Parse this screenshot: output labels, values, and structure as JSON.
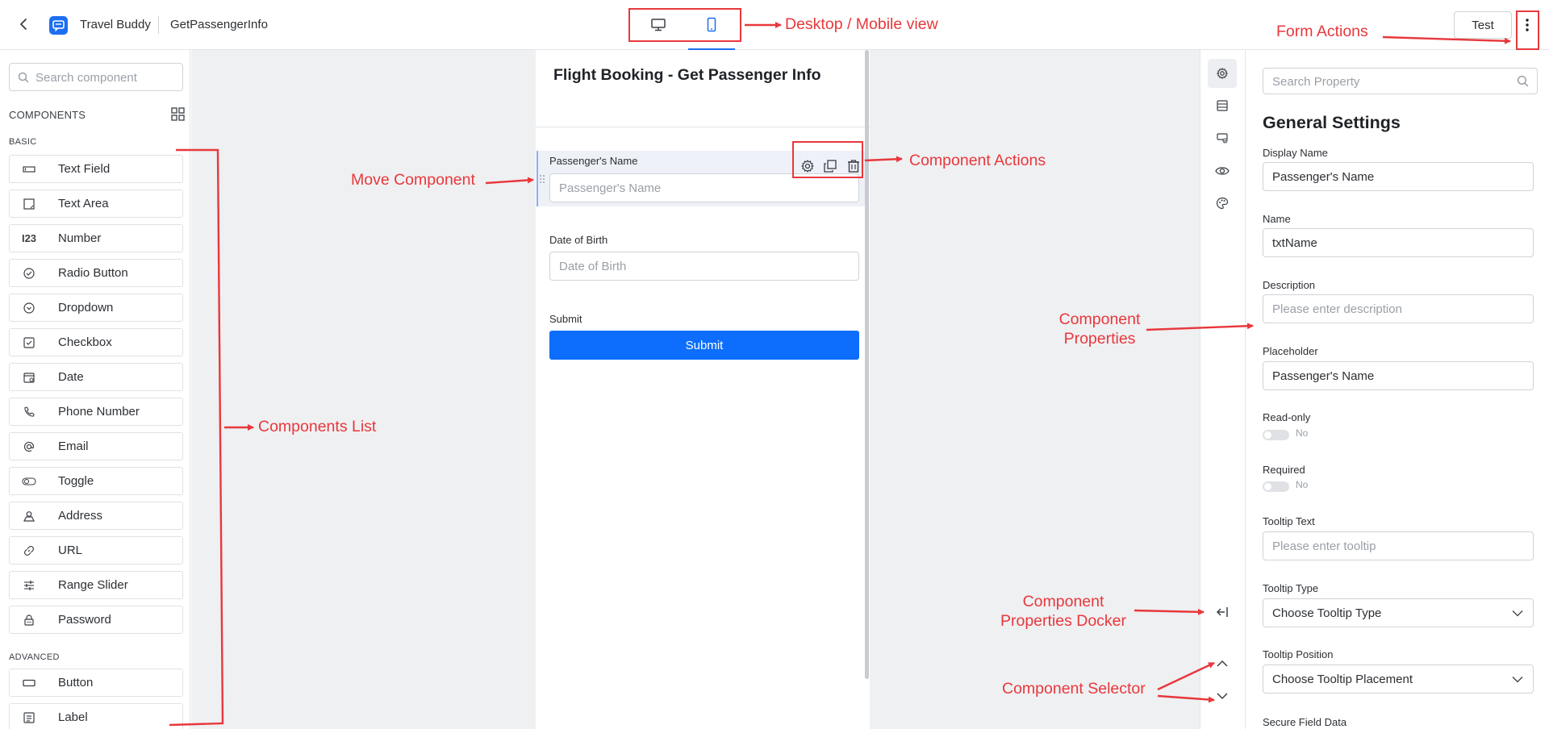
{
  "topbar": {
    "app_name": "Travel Buddy",
    "form_name": "GetPassengerInfo",
    "views": [
      "desktop-icon",
      "mobile-icon"
    ],
    "active_view": "mobile",
    "test_label": "Test"
  },
  "components": {
    "search_placeholder": "Search component",
    "header": "COMPONENTS",
    "basic_label": "BASIC",
    "basic": [
      {
        "label": "Text Field",
        "icon": "text-field-icon"
      },
      {
        "label": "Text Area",
        "icon": "text-area-icon"
      },
      {
        "label": "Number",
        "icon": "number-icon",
        "glyph": "I23"
      },
      {
        "label": "Radio Button",
        "icon": "radio-icon"
      },
      {
        "label": "Dropdown",
        "icon": "dropdown-icon"
      },
      {
        "label": "Checkbox",
        "icon": "checkbox-icon"
      },
      {
        "label": "Date",
        "icon": "calendar-icon"
      },
      {
        "label": "Phone Number",
        "icon": "phone-icon"
      },
      {
        "label": "Email",
        "icon": "at-icon"
      },
      {
        "label": "Toggle",
        "icon": "toggle-icon"
      },
      {
        "label": "Address",
        "icon": "address-icon"
      },
      {
        "label": "URL",
        "icon": "link-icon"
      },
      {
        "label": "Range Slider",
        "icon": "sliders-icon"
      },
      {
        "label": "Password",
        "icon": "lock-icon"
      }
    ],
    "advanced_label": "ADVANCED",
    "advanced": [
      {
        "label": "Button",
        "icon": "button-icon"
      },
      {
        "label": "Label",
        "icon": "label-icon"
      }
    ]
  },
  "form": {
    "title": "Flight Booking - Get Passenger Info",
    "fields": [
      {
        "label": "Passenger's Name",
        "placeholder": "Passenger's Name"
      },
      {
        "label": "Date of Birth",
        "placeholder": "Date of Birth"
      }
    ],
    "submit_label": "Submit",
    "submit_button": "Submit"
  },
  "properties": {
    "search_placeholder": "Search Property",
    "section_title": "General Settings",
    "display_name_label": "Display Name",
    "display_name_value": "Passenger's Name",
    "name_label": "Name",
    "name_value": "txtName",
    "description_label": "Description",
    "description_placeholder": "Please enter description",
    "placeholder_label": "Placeholder",
    "placeholder_value": "Passenger's Name",
    "readonly_label": "Read-only",
    "readonly_value": "No",
    "required_label": "Required",
    "required_value": "No",
    "tooltip_text_label": "Tooltip Text",
    "tooltip_text_placeholder": "Please enter tooltip",
    "tooltip_type_label": "Tooltip Type",
    "tooltip_type_value": "Choose Tooltip Type",
    "tooltip_position_label": "Tooltip Position",
    "tooltip_position_value": "Choose Tooltip Placement",
    "secure_label": "Secure Field Data"
  },
  "annotations": {
    "view": "Desktop / Mobile view",
    "form_actions": "Form Actions",
    "move": "Move Component",
    "comp_actions": "Component Actions",
    "comp_list": "Components List",
    "comp_props_1": "Component",
    "comp_props_2": "Properties",
    "docker_1": "Component",
    "docker_2": "Properties Docker",
    "selector": "Component Selector"
  },
  "colors": {
    "accent": "#1d6ff2",
    "submit": "#0d6efd",
    "annotation": "#e8383c"
  }
}
